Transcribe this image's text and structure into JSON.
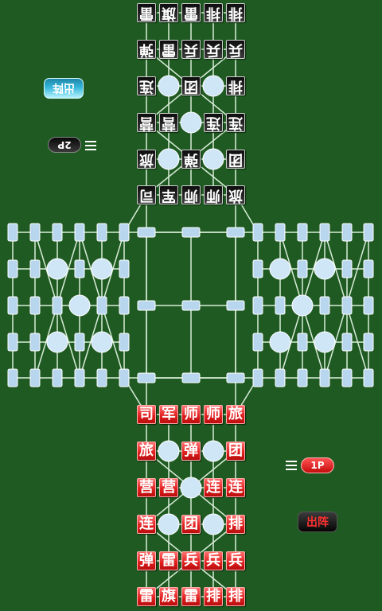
{
  "colors": {
    "board_green": "#1f5a22",
    "line": "#d8ecd8",
    "red_piece": "#e01e1e",
    "black_piece": "#111111",
    "camp_circle": "#cfe6f7",
    "station_slot": "#b8d7ef"
  },
  "top_player": {
    "label": "2P",
    "chuzhen_label": "出阵",
    "menu_icon": "hamburger-menu-icon",
    "rows": [
      [
        "雷",
        "旗",
        "雷",
        "排",
        "排"
      ],
      [
        "弹",
        "雷",
        "兵",
        "兵",
        "兵"
      ],
      [
        "连",
        "",
        "团",
        "",
        "排"
      ],
      [
        "营",
        "营",
        "",
        "连",
        "连"
      ],
      [
        "旅",
        "",
        "弹",
        "",
        "团"
      ],
      [
        "司",
        "军",
        "师",
        "师",
        "旅"
      ]
    ]
  },
  "bottom_player": {
    "label": "1P",
    "chuzhen_label": "出阵",
    "menu_icon": "hamburger-menu-icon",
    "rows": [
      [
        "司",
        "军",
        "师",
        "师",
        "旅"
      ],
      [
        "旅",
        "",
        "弹",
        "",
        "团"
      ],
      [
        "营",
        "营",
        "",
        "连",
        "连"
      ],
      [
        "连",
        "",
        "团",
        "",
        "排"
      ],
      [
        "弹",
        "雷",
        "兵",
        "兵",
        "兵"
      ],
      [
        "雷",
        "旗",
        "雷",
        "排",
        "排"
      ]
    ]
  }
}
